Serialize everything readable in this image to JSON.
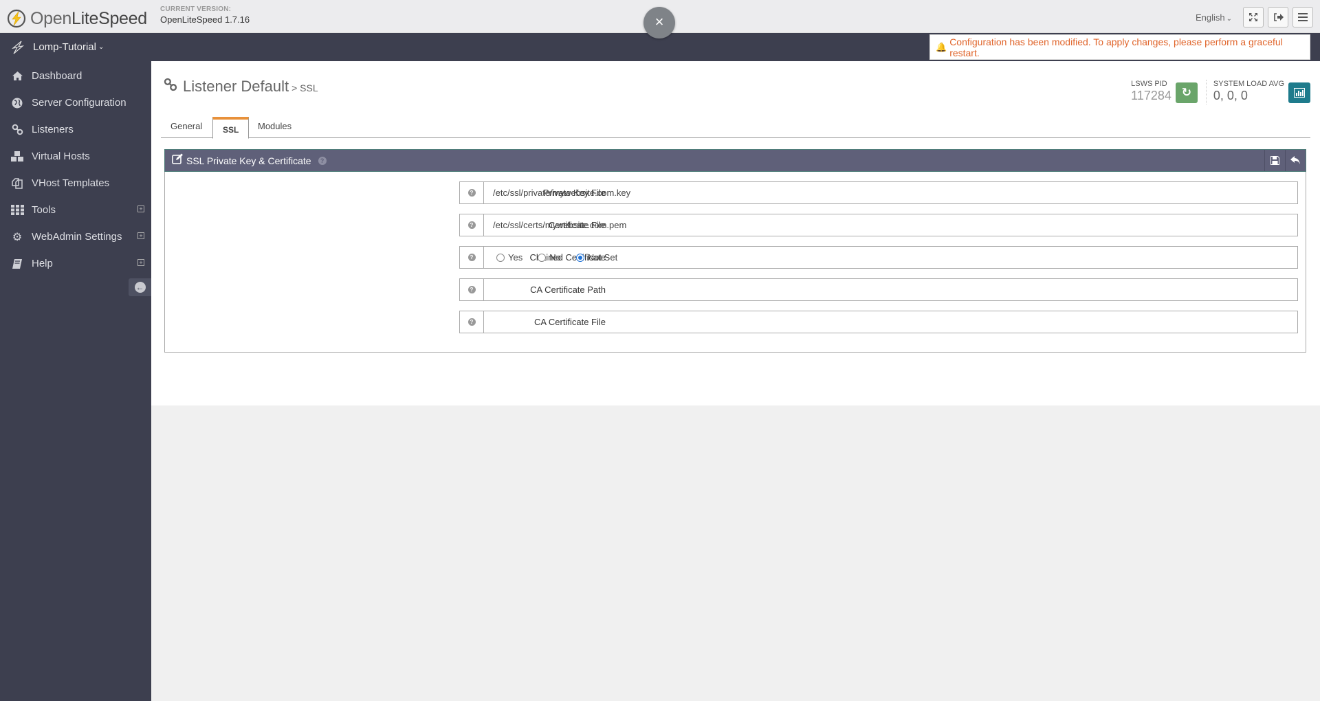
{
  "header": {
    "logo_light": "Open",
    "logo_bold": "LiteSpeed",
    "version_label": "CURRENT VERSION:",
    "version_value": "OpenLiteSpeed 1.7.16",
    "language": "English",
    "close_symbol": "×"
  },
  "navbar": {
    "site_name": "Lomp-Tutorial",
    "alert": "Configuration has been modified. To apply changes, please perform a graceful restart.",
    "alert_color": "#e0642a"
  },
  "sidebar": {
    "items": [
      {
        "label": "Dashboard",
        "icon": "home-icon",
        "expandable": false
      },
      {
        "label": "Server Configuration",
        "icon": "globe-icon",
        "expandable": false
      },
      {
        "label": "Listeners",
        "icon": "link-icon",
        "expandable": false
      },
      {
        "label": "Virtual Hosts",
        "icon": "cubes-icon",
        "expandable": false
      },
      {
        "label": "VHost Templates",
        "icon": "copy-icon",
        "expandable": false
      },
      {
        "label": "Tools",
        "icon": "grid-icon",
        "expandable": true
      },
      {
        "label": "WebAdmin Settings",
        "icon": "gear-icon",
        "expandable": true
      },
      {
        "label": "Help",
        "icon": "book-icon",
        "expandable": true
      }
    ]
  },
  "page": {
    "title": "Listener Default",
    "subtitle": "> SSL",
    "stats": {
      "pid_label": "LSWS PID",
      "pid_value": "117284",
      "load_label": "SYSTEM LOAD AVG",
      "load_value": "0, 0, 0",
      "restart_color": "#6aa56a",
      "chart_color": "#1e7b8c"
    },
    "tabs": [
      {
        "label": "General",
        "active": false
      },
      {
        "label": "SSL",
        "active": true
      },
      {
        "label": "Modules",
        "active": false
      }
    ]
  },
  "panel": {
    "title": "SSL Private Key & Certificate",
    "fields": [
      {
        "label": "Private Key File",
        "value": "/etc/ssl/private/mywebsite.com.key"
      },
      {
        "label": "Certificate File",
        "value": "/etc/ssl/certs/mywebsite.com.pem"
      },
      {
        "label": "Chained Certificate",
        "options": [
          "Yes",
          "No",
          "Not Set"
        ],
        "selected": "Not Set"
      },
      {
        "label": "CA Certificate Path",
        "value": ""
      },
      {
        "label": "CA Certificate File",
        "value": ""
      }
    ]
  }
}
